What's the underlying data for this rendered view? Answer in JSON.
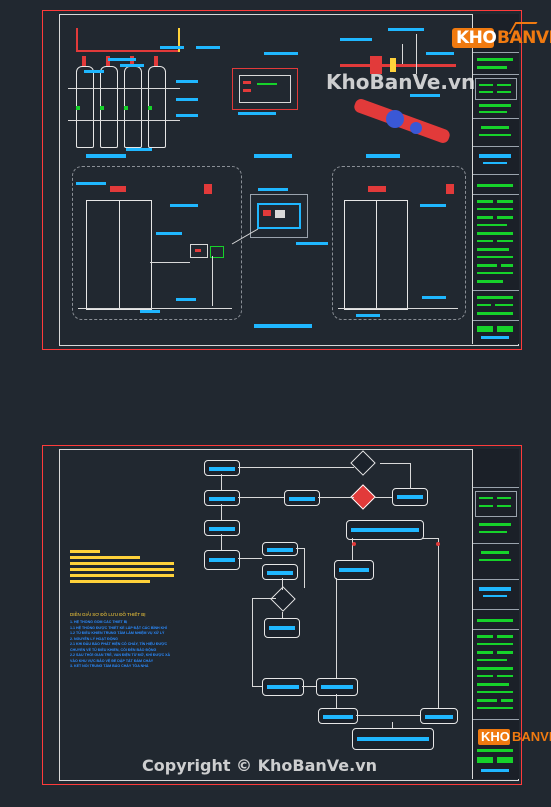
{
  "watermarks": {
    "top": "KhoBanVe.vn",
    "bottom": "Copyright © KhoBanVe.vn"
  },
  "logo": {
    "part1": "KHO",
    "part2": "BANVE"
  },
  "sheet2_notes": {
    "heading": "DIỄN GIẢI SƠ ĐỒ LƯU ĐỒ THIẾT BỊ",
    "body": "1. HỆ THỐNG GỒM CÁC THIẾT BỊ\n1.1 HỆ THỐNG ĐƯỢC THIẾT KẾ LẮP ĐẶT CÁC BÌNH KHÍ\n1.2 TỦ ĐIỀU KHIỂN TRUNG TÂM LÀM NHIỆM VỤ XỬ LÝ\n2. NGUYÊN LÝ HOẠT ĐỘNG\n2.1 KHI ĐẦU BÁO PHÁT HIỆN CÓ CHÁY, TÍN HIỆU ĐƯỢC\nCHUYỂN VỀ TỦ ĐIỀU KHIỂN, CÒI ĐÈN BÁO ĐỘNG\n2.2 SAU THỜI GIAN TRỄ, VAN ĐIỆN TỪ MỞ, KHÍ ĐƯỢC XẢ\nVÀO KHU VỰC BẢO VỆ ĐỂ DẬP TẮT ĐÁM CHÁY\n3. KẾT NỐI TRUNG TÂM BÁO CHÁY TÒA NHÀ"
  },
  "colors": {
    "background": "#212830",
    "sheet_border": "#ff3b3b",
    "cyan": "#1fb7ff",
    "green": "#16d22a",
    "red": "#e23a3a",
    "yellow": "#ffd23a",
    "logo_orange": "#f07a10"
  }
}
